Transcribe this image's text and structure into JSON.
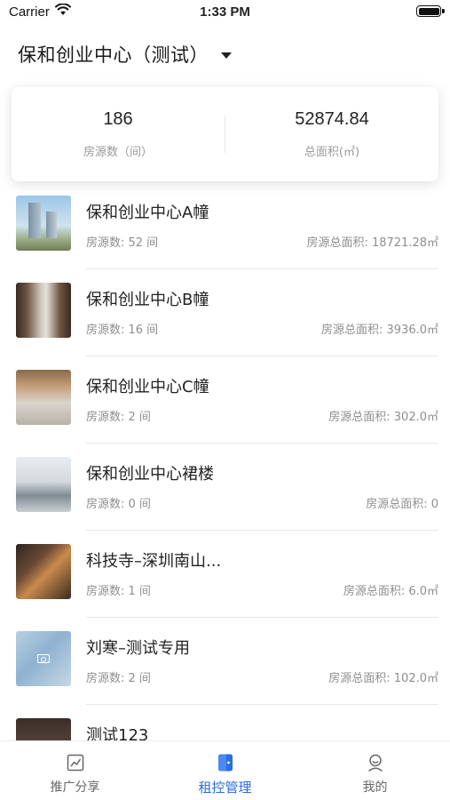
{
  "status_bar": {
    "carrier": "Carrier",
    "time": "1:33 PM"
  },
  "header": {
    "project_name": "保和创业中心（测试）"
  },
  "summary": {
    "rooms_value": "186",
    "rooms_label": "房源数（间）",
    "area_value": "52874.84",
    "area_label": "总面积(㎡)"
  },
  "list": [
    {
      "title": "保和创业中心A幢",
      "count": "房源数: 52 间",
      "area": "房源总面积: 18721.28㎡"
    },
    {
      "title": "保和创业中心B幢",
      "count": "房源数: 16 间",
      "area": "房源总面积: 3936.0㎡"
    },
    {
      "title": "保和创业中心C幢",
      "count": "房源数: 2 间",
      "area": "房源总面积: 302.0㎡"
    },
    {
      "title": "保和创业中心裙楼",
      "count": "房源数: 0 间",
      "area": "房源总面积: 0"
    },
    {
      "title": "科技寺–深圳南山...",
      "count": "房源数: 1 间",
      "area": "房源总面积: 6.0㎡"
    },
    {
      "title": "刘寒–测试专用",
      "count": "房源数: 2 间",
      "area": "房源总面积: 102.0㎡"
    },
    {
      "title": "测试123",
      "count": "",
      "area": ""
    }
  ],
  "tabs": [
    {
      "label": "推广分享",
      "icon": "chart-icon"
    },
    {
      "label": "租控管理",
      "icon": "door-icon"
    },
    {
      "label": "我的",
      "icon": "profile-icon"
    }
  ],
  "colors": {
    "accent": "#2c6fdc",
    "text_primary": "#222222",
    "text_secondary": "#8e8e8e"
  }
}
